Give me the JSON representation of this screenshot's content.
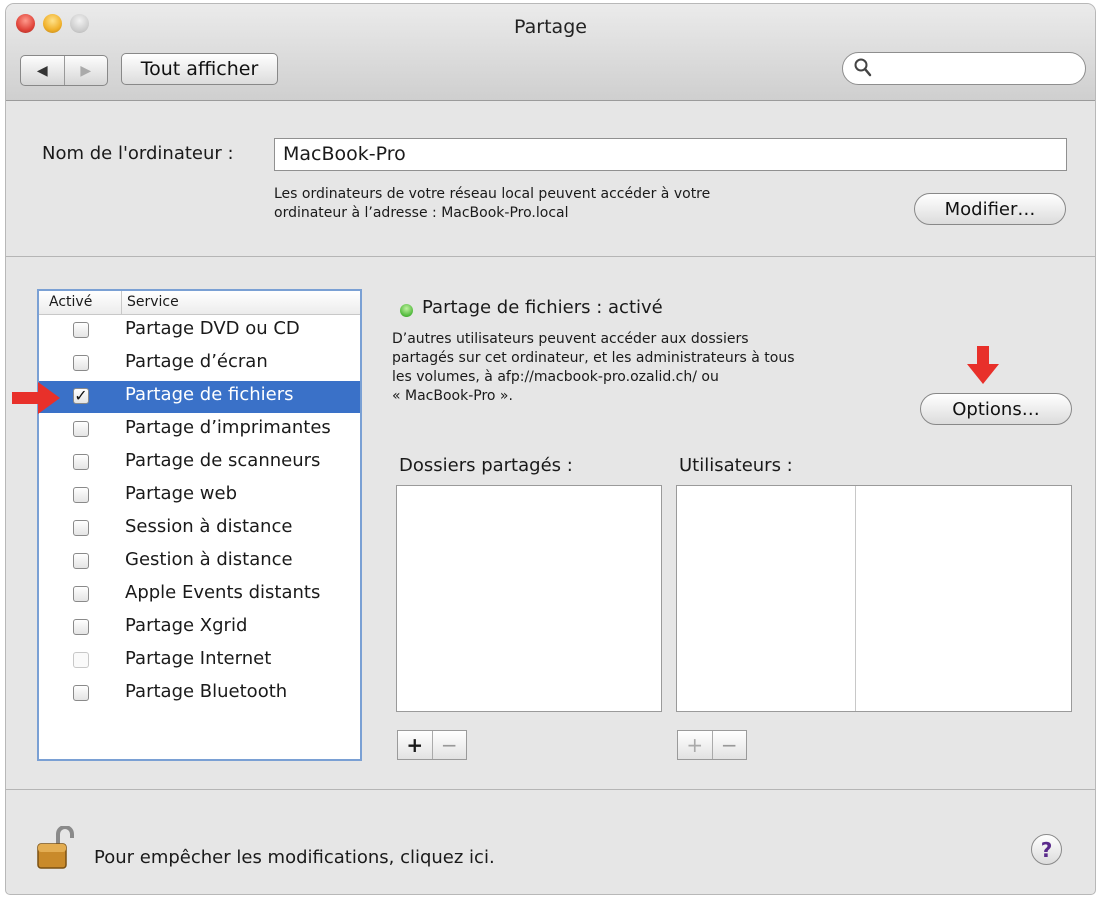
{
  "window": {
    "title": "Partage"
  },
  "toolbar": {
    "back_icon": "◀",
    "forward_icon": "▶",
    "show_all_label": "Tout afficher",
    "search_placeholder": "",
    "search_icon": "🔍"
  },
  "computer": {
    "label": "Nom de l'ordinateur :",
    "name_value": "MacBook-Pro",
    "info_line1": "Les ordinateurs de votre réseau local peuvent accéder à votre",
    "info_line2": "ordinateur à l’adresse : MacBook-Pro.local",
    "modify_label": "Modifier…"
  },
  "services": {
    "col_active": "Activé",
    "col_service": "Service",
    "items": [
      {
        "label": "Partage DVD ou CD",
        "checked": false,
        "selected": false,
        "enabled": true
      },
      {
        "label": "Partage d’écran",
        "checked": false,
        "selected": false,
        "enabled": true
      },
      {
        "label": "Partage de fichiers",
        "checked": true,
        "selected": true,
        "enabled": true
      },
      {
        "label": "Partage d’imprimantes",
        "checked": false,
        "selected": false,
        "enabled": true
      },
      {
        "label": "Partage de scanneurs",
        "checked": false,
        "selected": false,
        "enabled": true
      },
      {
        "label": "Partage web",
        "checked": false,
        "selected": false,
        "enabled": true
      },
      {
        "label": "Session à distance",
        "checked": false,
        "selected": false,
        "enabled": true
      },
      {
        "label": "Gestion à distance",
        "checked": false,
        "selected": false,
        "enabled": true
      },
      {
        "label": "Apple Events distants",
        "checked": false,
        "selected": false,
        "enabled": true
      },
      {
        "label": "Partage Xgrid",
        "checked": false,
        "selected": false,
        "enabled": true
      },
      {
        "label": "Partage Internet",
        "checked": false,
        "selected": false,
        "enabled": false
      },
      {
        "label": "Partage Bluetooth",
        "checked": false,
        "selected": false,
        "enabled": true
      }
    ]
  },
  "detail": {
    "status": "Partage de fichiers : activé",
    "status_color": "#4fb83a",
    "desc1": "D’autres utilisateurs peuvent accéder aux dossiers",
    "desc2": "partagés sur cet ordinateur, et les administrateurs à tous",
    "desc3": "les volumes, à afp://macbook-pro.ozalid.ch/ ou",
    "desc4": "« MacBook-Pro ».",
    "options_label": "Options…",
    "shared_folders_label": "Dossiers partagés :",
    "users_label": "Utilisateurs :",
    "plus": "+",
    "minus": "−"
  },
  "footer": {
    "lock_text": "Pour empêcher les modifications, cliquez ici.",
    "help": "?"
  },
  "colors": {
    "selection": "#3a71c8",
    "annotation_arrow": "#e8302a"
  }
}
